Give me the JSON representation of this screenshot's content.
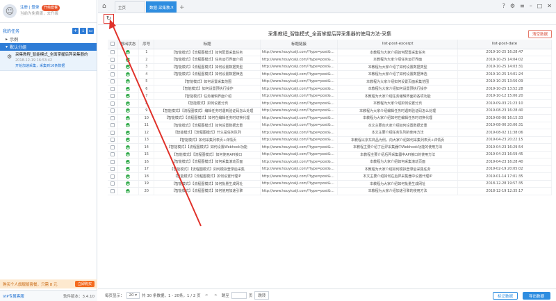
{
  "sidebar": {
    "user_links": "注册 | 登录",
    "upgrade": "升级套餐",
    "user_hint": "当前为免费版，去升级",
    "section_title": "我的任务",
    "group_example": "示例",
    "group_default": "默认分组",
    "task": {
      "title": "采集教程_智能模式_全面掌握后羿采集器的",
      "time": "2018-12-19 16:53:42",
      "status": "开始加速采集，采集到16条数据"
    },
    "promo_text": "购买个人旗舰版套餐，只需 8 元",
    "promo_button": "立即购买",
    "vip_link": "VIP专属客服",
    "version": "软件版本：3.4.10"
  },
  "tabs": [
    {
      "label": "主页"
    },
    {
      "label": "数据-采集教..."
    }
  ],
  "main": {
    "page_title": "采集教程_智能模式_全面掌握后羿采集器的使用方法-采集",
    "clear_button": "清空数据",
    "columns": [
      "导出状态",
      "序号",
      "标题",
      "标题链接",
      "list-post-excerpt",
      "list-post-date"
    ],
    "rows": [
      {
        "no": "1",
        "title": "【智能模式】【流程图模式】如何配置采集任务",
        "link": "http://www.houyicaiji.com/?type=post&pid=7955",
        "excerpt": "本教程为大家介绍如何配置采集任务",
        "date": "2019-10-25 16:28:47"
      },
      {
        "no": "2",
        "title": "【智能模式】【流程图模式】任务运行界面介绍",
        "link": "http://www.houyicaiji.com/?type=post&pid=7809",
        "excerpt": "本教程为大家介绍任务运行界面",
        "date": "2019-10-25 14:04:02"
      },
      {
        "no": "3",
        "title": "【智能模式】【流程图模式】如何设置数据类型",
        "link": "http://www.houyicaiji.com/?type=post&pid=7803",
        "excerpt": "本教程为大家介绍了如何设置数据类型",
        "date": "2019-10-25 14:03:31"
      },
      {
        "no": "4",
        "title": "【智能模式】【流程图模式】如何设置数据筛选",
        "link": "http://www.houyicaiji.com/?type=post&pid=7805",
        "excerpt": "本教程为大家介绍了如何设置数据筛选",
        "date": "2019-10-25 14:01:24"
      },
      {
        "no": "5",
        "title": "【智能模式】如何设置采集范围",
        "link": "http://www.houyicaiji.com/?type=post&pid=7803",
        "excerpt": "本教程为大家介绍如何设置页面采集范围",
        "date": "2019-10-25 13:56:09"
      },
      {
        "no": "6",
        "title": "【智能模式】如何设置预执行操作",
        "link": "http://www.houyicaiji.com/?type=post&pid=7801",
        "excerpt": "本教程为大家介绍如何设置预执行操作",
        "date": "2019-10-25 13:52:28"
      },
      {
        "no": "7",
        "title": "【智能模式】任务编辑界面介绍",
        "link": "http://www.houyicaiji.com/?type=post&pid=7725",
        "excerpt": "本教程为大家介绍任务编辑界面的各项功能",
        "date": "2019-10-12 15:06:20"
      },
      {
        "no": "8",
        "title": "【智能模式】如何设置分页",
        "link": "http://www.houyicaiji.com/?type=post&pid=7489",
        "excerpt": "本教程为大家介绍如何设置分页",
        "date": "2019-09-03 21:23:10"
      },
      {
        "no": "9",
        "title": "【智能模式】【流程图模式】编辑任务时遇到验证码怎么处理",
        "link": "http://www.houyicaiji.com/?type=post&pid=7423",
        "excerpt": "本教程为大家介绍编辑任务时遇到验证码怎么处理",
        "date": "2019-08-23 16:28:40"
      },
      {
        "no": "10",
        "title": "【智能模式】【流程图模式】如何在编辑任务时切换代理",
        "link": "http://www.houyicaiji.com/?type=post&pid=7334",
        "excerpt": "本教程为大家介绍如何在编辑任务时切换代理",
        "date": "2019-08-06 16:15:33"
      },
      {
        "no": "11",
        "title": "【智能模式】【流程图模式】如何设置数据去重",
        "link": "http://www.houyicaiji.com/?type=post&pid=7325",
        "excerpt": "本文主要向大家介绍如何设置数据去重",
        "date": "2019-08-06 20:06:31"
      },
      {
        "no": "12",
        "title": "【智能模式】【流程图模式】什么是任务队列",
        "link": "http://www.houyicaiji.com/?type=post&pid=7317",
        "excerpt": "本文主要介绍任务队列的使用方法",
        "date": "2019-08-02 11:38:06"
      },
      {
        "no": "13",
        "title": "【智能模式】如何采集列表页+详情页",
        "link": "http://www.houyicaiji.com/?type=post&pid=6958",
        "excerpt": "本教程以京东商品为例，向大家介绍如何采集列表页+详情页",
        "date": "2019-04-23 20:22:15"
      },
      {
        "no": "14",
        "title": "【智能模式】【流程图模式】如何设置Webhook功能",
        "link": "http://www.houyicaiji.com/?type=post&pid=6925",
        "excerpt": "本教程主要介绍了后羿采集器中Webhook功能的使用方法",
        "date": "2019-04-23 16:29:54"
      },
      {
        "no": "15",
        "title": "【智能模式】【流程图模式】如何使用API接口",
        "link": "http://www.houyicaiji.com/?type=post&pid=6915",
        "excerpt": "本教程主要介绍后羿采集器中API接口的使用方法",
        "date": "2019-04-23 16:59:45"
      },
      {
        "no": "16",
        "title": "【智能模式】【流程图模式】如何采集滚动页面",
        "link": "http://www.houyicaiji.com/?type=post&pid=6293",
        "excerpt": "本教程为大家介绍如何采集滚动页面",
        "date": "2019-04-23 16:28:40"
      },
      {
        "no": "17",
        "title": "【智能模式】【流程图模式】如何模拟登录后采集",
        "link": "http://www.houyicaiji.com/?type=post&pid=5582",
        "excerpt": "本教程为大家介绍如何模拟登录后采集任务",
        "date": "2019-02-19 20:05:02"
      },
      {
        "no": "18",
        "title": "【智能模式】【流程图模式】如何设置代理IP",
        "link": "http://www.houyicaiji.com/?type=post&pid=4890",
        "excerpt": "本文主要介绍如何在后羿采集器中设置代理IP",
        "date": "2019-01-14 17:01:35"
      },
      {
        "no": "19",
        "title": "【智能模式】【流程图模式】如何批量生成网址",
        "link": "http://www.houyicaiji.com/?type=post&pid=4701",
        "excerpt": "本教程为大家介绍如何批量生成网址",
        "date": "2018-12-28 19:57:35"
      },
      {
        "no": "20",
        "title": "【智能模式】【流程图模式】如何使用加速引擎",
        "link": "http://www.houyicaiji.com/?type=post&pid=4484",
        "excerpt": "本教程为大家介绍加速引擎的使用方法",
        "date": "2018-12-19 12:35:17"
      }
    ]
  },
  "pager": {
    "per_page_label": "每页显示：",
    "per_page": "20",
    "summary": "共 30 条数据，1 - 20条，1 / 2 页",
    "prev": "<",
    "next": ">",
    "jump_label": "跳至",
    "page_unit": "页",
    "jump_button": "跳转"
  },
  "actions": {
    "mark_button": "标记数据",
    "export_button": "导出数据"
  },
  "colors": {
    "accent": "#2e8de0",
    "status_ok": "#2fa948",
    "annotation": "#e0312a"
  }
}
